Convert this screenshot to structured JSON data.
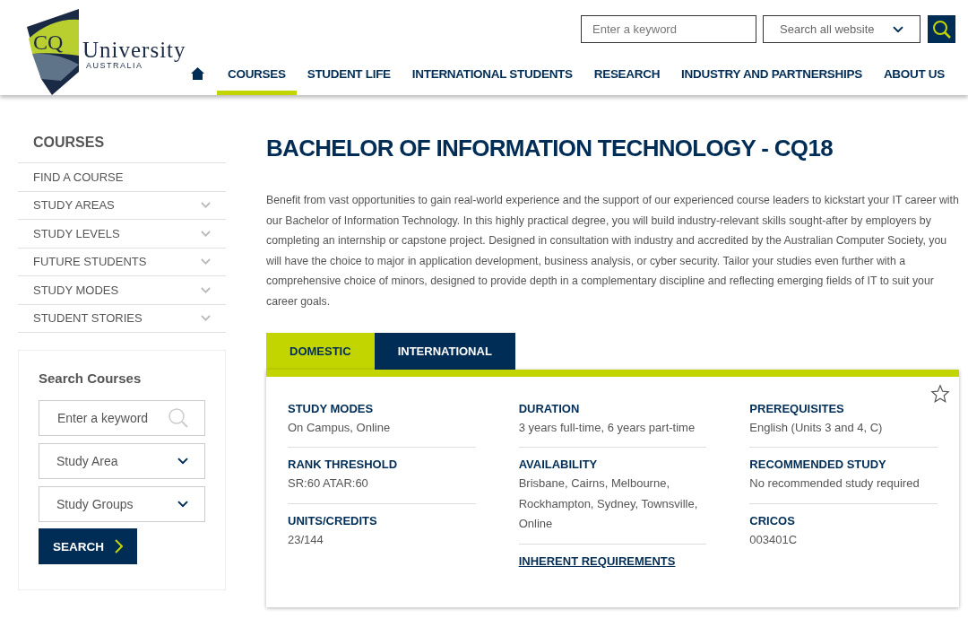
{
  "logo": {
    "mark": "CQ",
    "name": "University",
    "tagline": "AUSTRALIA"
  },
  "header_search": {
    "placeholder": "Enter a keyword",
    "scope": "Search all website"
  },
  "nav": [
    {
      "label": "COURSES",
      "selected": true
    },
    {
      "label": "STUDENT LIFE",
      "selected": false
    },
    {
      "label": "INTERNATIONAL STUDENTS",
      "selected": false
    },
    {
      "label": "RESEARCH",
      "selected": false
    },
    {
      "label": "INDUSTRY AND PARTNERSHIPS",
      "selected": false
    },
    {
      "label": "ABOUT US",
      "selected": false
    }
  ],
  "sidebar": {
    "title": "COURSES",
    "items": [
      {
        "label": "FIND A COURSE",
        "expandable": false
      },
      {
        "label": "STUDY AREAS",
        "expandable": true
      },
      {
        "label": "STUDY LEVELS",
        "expandable": true
      },
      {
        "label": "FUTURE STUDENTS",
        "expandable": true
      },
      {
        "label": "STUDY MODES",
        "expandable": true
      },
      {
        "label": "STUDENT STORIES",
        "expandable": true
      }
    ]
  },
  "search_courses": {
    "title": "Search Courses",
    "placeholder": "Enter a keyword",
    "selects": [
      "Study Area",
      "Study Groups"
    ],
    "button": "SEARCH"
  },
  "course": {
    "title": "BACHELOR OF INFORMATION TECHNOLOGY - CQ18",
    "description": "Benefit from vast opportunities to gain real-world experience and the support of our experienced course leaders to kickstart your IT career with our Bachelor of Information Technology. In this highly practical degree, you will build industry-relevant skills sought-after by employers by completing an internship or capstone project. Designed in consultation with industry and accredited by the Australian Computer Society, you will have the choice to major in application development, business analysis, or cyber security. Tailor your studies even further with a comprehensive choice of minors, designed to provide depth in a complementary discipline and reflecting emerging fields of IT to suit your career goals.",
    "tabs": [
      {
        "label": "DOMESTIC",
        "selected": true
      },
      {
        "label": "INTERNATIONAL",
        "selected": false
      }
    ],
    "columns": [
      [
        {
          "kind": "field",
          "label": "STUDY MODES",
          "value": "On Campus, Online"
        },
        {
          "kind": "field",
          "label": "RANK THRESHOLD",
          "value": "SR:60 ATAR:60"
        },
        {
          "kind": "field",
          "label": "UNITS/CREDITS",
          "value": "23/144"
        }
      ],
      [
        {
          "kind": "field",
          "label": "DURATION",
          "value": "3 years full-time, 6 years part-time"
        },
        {
          "kind": "field",
          "label": "AVAILABILITY",
          "value": "Brisbane, Cairns, Melbourne, Rockhampton, Sydney, Townsville, Online"
        },
        {
          "kind": "link",
          "label": "INHERENT REQUIREMENTS"
        }
      ],
      [
        {
          "kind": "field",
          "label": "PREREQUISITES",
          "value": "English (Units 3 and 4, C)"
        },
        {
          "kind": "field",
          "label": "RECOMMENDED STUDY",
          "value": "No recommended study required"
        },
        {
          "kind": "field",
          "label": "CRICOS",
          "value": "003401C"
        }
      ]
    ]
  }
}
